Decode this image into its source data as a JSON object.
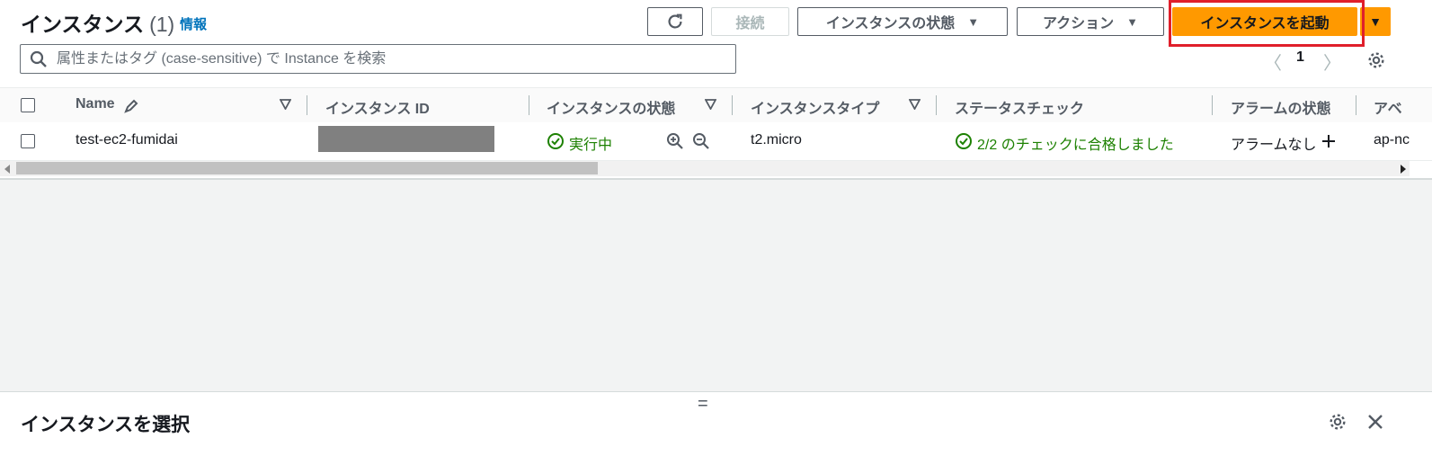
{
  "header": {
    "title": "インスタンス",
    "count": "(1)",
    "info": "情報"
  },
  "toolbar": {
    "refresh_icon": "refresh-icon",
    "connect": "接続",
    "instance_state": "インスタンスの状態",
    "actions": "アクション",
    "launch": "インスタンスを起動",
    "caret": "▼"
  },
  "search": {
    "placeholder": "属性またはタグ (case-sensitive) で Instance を検索"
  },
  "pagination": {
    "prev": "〈",
    "page": "1",
    "next": "〉"
  },
  "table": {
    "columns": [
      "Name",
      "インスタンス ID",
      "インスタンスの状態",
      "インスタンスタイプ",
      "ステータスチェック",
      "アラームの状態",
      "アベ"
    ],
    "rows": [
      {
        "name": "test-ec2-fumidai",
        "instance_id": "",
        "state": "実行中",
        "type": "t2.micro",
        "status_check": "2/2 のチェックに合格しました",
        "alarm": "アラームなし",
        "az": "ap-nc"
      }
    ]
  },
  "bottom_panel": {
    "handle": "=",
    "title": "インスタンスを選択"
  },
  "colors": {
    "primary": "#ff9900",
    "link": "#0073bb",
    "success": "#1d8102",
    "highlight": "#e01f2b"
  }
}
